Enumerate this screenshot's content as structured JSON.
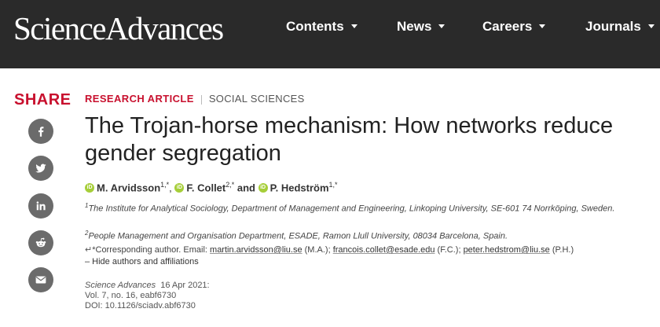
{
  "header": {
    "logo": "ScienceAdvances",
    "nav": [
      "Contents",
      "News",
      "Careers",
      "Journals"
    ]
  },
  "share": {
    "label": "SHARE",
    "buttons": [
      "facebook-icon",
      "twitter-icon",
      "linkedin-icon",
      "reddit-icon",
      "email-icon"
    ]
  },
  "article": {
    "type": "RESEARCH ARTICLE",
    "section": "SOCIAL SCIENCES",
    "title": "The Trojan-horse mechanism: How networks reduce gender segregation",
    "authors": [
      {
        "name": "M. Arvidsson",
        "sup": "1,*",
        "after": ", "
      },
      {
        "name": "F. Collet",
        "sup": "2,*",
        "after": " and "
      },
      {
        "name": "P. Hedström",
        "sup": "1,*",
        "after": ""
      }
    ],
    "affiliations": [
      {
        "num": "1",
        "text": "The Institute for Analytical Sociology, Department of Management and Engineering, Linkoping University, SE-601 74 Norrköping, Sweden."
      },
      {
        "num": "2",
        "text": "People Management and Organisation Department, ESADE, Ramon Llull University, 08034 Barcelona, Spain."
      }
    ],
    "corresponding": {
      "prefix": "*Corresponding author. Email: ",
      "entries": [
        {
          "email": "martin.arvidsson@liu.se",
          "initials": " (M.A.); "
        },
        {
          "email": "francois.collet@esade.edu",
          "initials": " (F.C.); "
        },
        {
          "email": "peter.hedstrom@liu.se",
          "initials": " (P.H.)"
        }
      ]
    },
    "toggle": "– Hide authors and affiliations",
    "citation": {
      "journal": "Science Advances",
      "date": "16 Apr 2021:",
      "volume": "Vol. 7, no. 16, eabf6730",
      "doi": "DOI: 10.1126/sciadv.abf6730"
    }
  },
  "colors": {
    "header_bg": "#2a2a2a",
    "accent_red": "#c8102e",
    "share_circle": "#6b6b6b",
    "orcid_green": "#a6ce39"
  }
}
